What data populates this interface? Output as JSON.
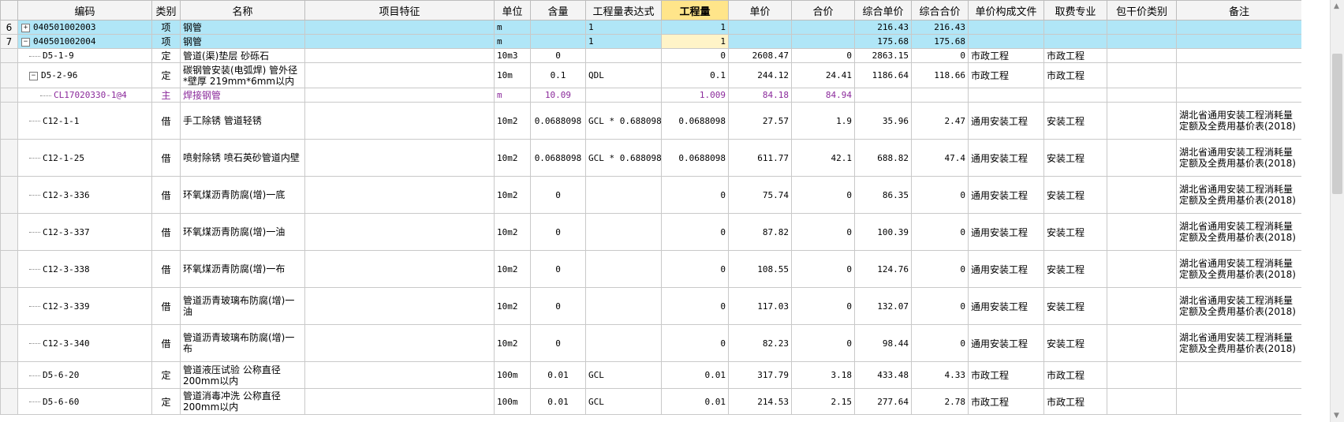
{
  "headers": {
    "code": "编码",
    "type": "类别",
    "name": "名称",
    "feature": "项目特征",
    "unit": "单位",
    "content": "含量",
    "expr": "工程量表达式",
    "qty": "工程量",
    "price": "单价",
    "total": "合价",
    "cprice": "综合单价",
    "ctotal": "综合合价",
    "file": "单价构成文件",
    "fee": "取费专业",
    "pkg": "包干价类别",
    "remark": "备注"
  },
  "rows": [
    {
      "no": "6",
      "toggle": "+",
      "code": "040501002003",
      "type": "项",
      "name": "钢管",
      "unit": "m",
      "content": "",
      "expr": "1",
      "qty": "1",
      "price": "",
      "total": "",
      "cprice": "216.43",
      "ctotal": "216.43",
      "file": "",
      "fee": "",
      "remark": ""
    },
    {
      "no": "7",
      "toggle": "−",
      "code": "040501002004",
      "type": "项",
      "name": "钢管",
      "unit": "m",
      "content": "",
      "expr": "1",
      "qty": "1",
      "price": "",
      "total": "",
      "cprice": "175.68",
      "ctotal": "175.68",
      "file": "",
      "fee": "",
      "remark": ""
    },
    {
      "no": "",
      "code": "D5-1-9",
      "type": "定",
      "name": "管道(渠)垫层 砂砾石",
      "unit": "10m3",
      "content": "0",
      "expr": "",
      "qty": "0",
      "price": "2608.47",
      "total": "0",
      "cprice": "2863.15",
      "ctotal": "0",
      "file": "市政工程",
      "fee": "市政工程",
      "remark": ""
    },
    {
      "no": "",
      "toggle": "−",
      "code": "D5-2-96",
      "type": "定",
      "name": "碳钢管安装(电弧焊) 管外径*壁厚 219mm*6mm以内",
      "unit": "10m",
      "content": "0.1",
      "expr": "QDL",
      "qty": "0.1",
      "price": "244.12",
      "total": "24.41",
      "cprice": "1186.64",
      "ctotal": "118.66",
      "file": "市政工程",
      "fee": "市政工程",
      "remark": ""
    },
    {
      "no": "",
      "code": "CL17020330-1@4",
      "type": "主",
      "name": "焊接钢管",
      "unit": "m",
      "content": "10.09",
      "expr": "",
      "qty": "1.009",
      "price": "84.18",
      "total": "84.94",
      "cprice": "",
      "ctotal": "",
      "file": "",
      "fee": "",
      "remark": ""
    },
    {
      "no": "",
      "code": "C12-1-1",
      "type": "借",
      "name": "手工除锈 管道轻锈",
      "unit": "10m2",
      "content": "0.0688098",
      "expr": "GCL * 0.688098",
      "qty": "0.0688098",
      "price": "27.57",
      "total": "1.9",
      "cprice": "35.96",
      "ctotal": "2.47",
      "file": "通用安装工程",
      "fee": "安装工程",
      "remark": "湖北省通用安装工程消耗量定额及全费用基价表(2018)"
    },
    {
      "no": "",
      "code": "C12-1-25",
      "type": "借",
      "name": "喷射除锈 喷石英砂管道内壁",
      "unit": "10m2",
      "content": "0.0688098",
      "expr": "GCL * 0.688098",
      "qty": "0.0688098",
      "price": "611.77",
      "total": "42.1",
      "cprice": "688.82",
      "ctotal": "47.4",
      "file": "通用安装工程",
      "fee": "安装工程",
      "remark": "湖北省通用安装工程消耗量定额及全费用基价表(2018)"
    },
    {
      "no": "",
      "code": "C12-3-336",
      "type": "借",
      "name": "环氧煤沥青防腐(增)一底",
      "unit": "10m2",
      "content": "0",
      "expr": "",
      "qty": "0",
      "price": "75.74",
      "total": "0",
      "cprice": "86.35",
      "ctotal": "0",
      "file": "通用安装工程",
      "fee": "安装工程",
      "remark": "湖北省通用安装工程消耗量定额及全费用基价表(2018)"
    },
    {
      "no": "",
      "code": "C12-3-337",
      "type": "借",
      "name": "环氧煤沥青防腐(增)一油",
      "unit": "10m2",
      "content": "0",
      "expr": "",
      "qty": "0",
      "price": "87.82",
      "total": "0",
      "cprice": "100.39",
      "ctotal": "0",
      "file": "通用安装工程",
      "fee": "安装工程",
      "remark": "湖北省通用安装工程消耗量定额及全费用基价表(2018)"
    },
    {
      "no": "",
      "code": "C12-3-338",
      "type": "借",
      "name": "环氧煤沥青防腐(增)一布",
      "unit": "10m2",
      "content": "0",
      "expr": "",
      "qty": "0",
      "price": "108.55",
      "total": "0",
      "cprice": "124.76",
      "ctotal": "0",
      "file": "通用安装工程",
      "fee": "安装工程",
      "remark": "湖北省通用安装工程消耗量定额及全费用基价表(2018)"
    },
    {
      "no": "",
      "code": "C12-3-339",
      "type": "借",
      "name": "管道沥青玻璃布防腐(增)一油",
      "unit": "10m2",
      "content": "0",
      "expr": "",
      "qty": "0",
      "price": "117.03",
      "total": "0",
      "cprice": "132.07",
      "ctotal": "0",
      "file": "通用安装工程",
      "fee": "安装工程",
      "remark": "湖北省通用安装工程消耗量定额及全费用基价表(2018)"
    },
    {
      "no": "",
      "code": "C12-3-340",
      "type": "借",
      "name": "管道沥青玻璃布防腐(增)一布",
      "unit": "10m2",
      "content": "0",
      "expr": "",
      "qty": "0",
      "price": "82.23",
      "total": "0",
      "cprice": "98.44",
      "ctotal": "0",
      "file": "通用安装工程",
      "fee": "安装工程",
      "remark": "湖北省通用安装工程消耗量定额及全费用基价表(2018)"
    },
    {
      "no": "",
      "code": "D5-6-20",
      "type": "定",
      "name": "管道液压试验 公称直径200mm以内",
      "unit": "100m",
      "content": "0.01",
      "expr": "GCL",
      "qty": "0.01",
      "price": "317.79",
      "total": "3.18",
      "cprice": "433.48",
      "ctotal": "4.33",
      "file": "市政工程",
      "fee": "市政工程",
      "remark": ""
    },
    {
      "no": "",
      "code": "D5-6-60",
      "type": "定",
      "name": "管道消毒冲洗 公称直径200mm以内",
      "unit": "100m",
      "content": "0.01",
      "expr": "GCL",
      "qty": "0.01",
      "price": "214.53",
      "total": "2.15",
      "cprice": "277.64",
      "ctotal": "2.78",
      "file": "市政工程",
      "fee": "市政工程",
      "remark": ""
    }
  ],
  "colors": {
    "list_row": "#b0e6f7",
    "main_material": "#8b2a9b",
    "highlight_header": "#ffe58a"
  }
}
